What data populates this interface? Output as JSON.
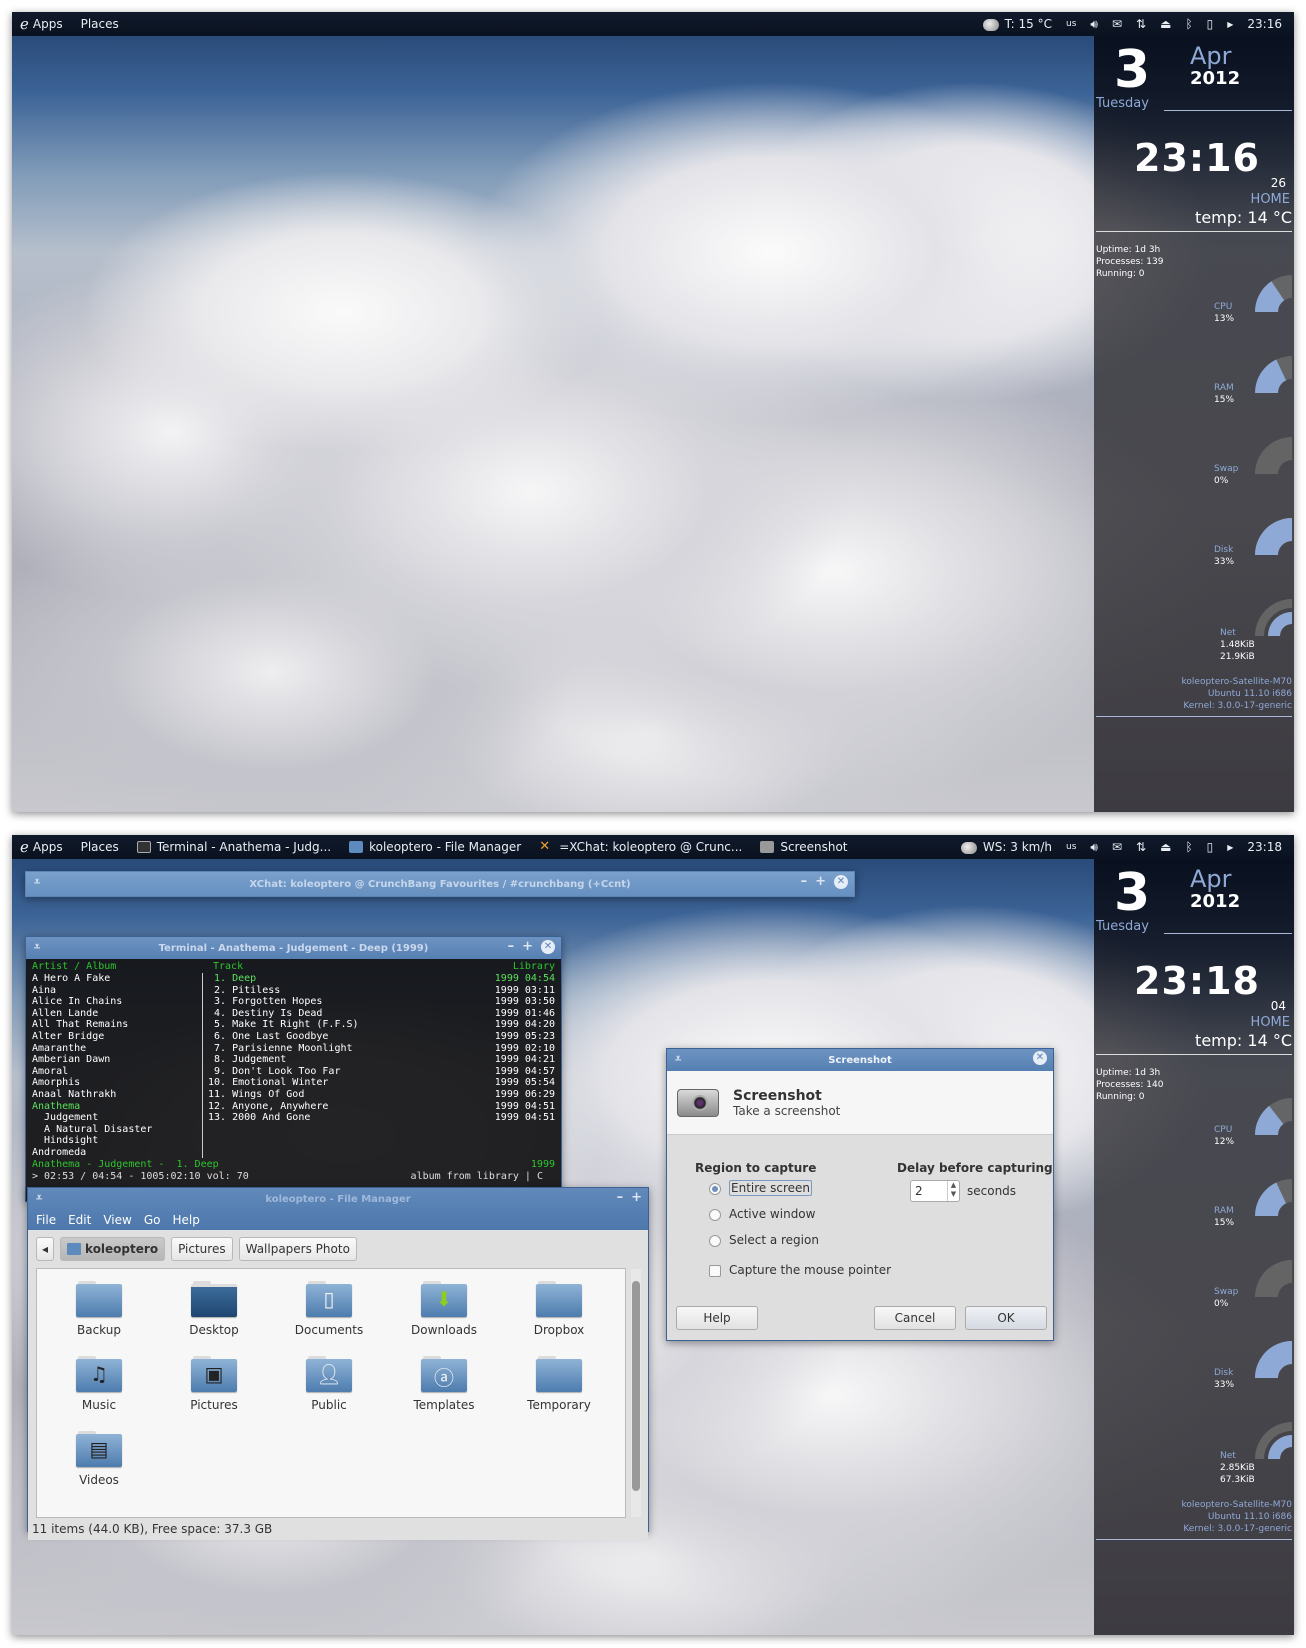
{
  "screens": [
    {
      "panel": {
        "apps": "Apps",
        "places": "Places",
        "tasks": [],
        "weather": "T: 15 °C",
        "keyboard": "us",
        "clock": "23:16"
      },
      "conky": {
        "day": "3",
        "month": "Apr",
        "year": "2012",
        "weekday": "Tuesday",
        "time": "23:16",
        "seconds": "26",
        "location": "HOME",
        "temp": "temp: 14 °C",
        "uptime": "Uptime: 1d 3h",
        "processes": "Processes: 139",
        "running": "Running: 0",
        "gauges": [
          {
            "label": "CPU",
            "value_text": "13%",
            "percent": 13
          },
          {
            "label": "RAM",
            "value_text": "15%",
            "percent": 15
          },
          {
            "label": "Swap",
            "value_text": "0%",
            "percent": 0
          },
          {
            "label": "Disk",
            "value_text": "33%",
            "percent": 33
          }
        ],
        "net": {
          "label": "Net",
          "down": "1.48KiB",
          "up": "21.9KiB"
        },
        "host": "koleoptero-Satellite-M70",
        "os": "Ubuntu 11.10  i686",
        "kernel": "Kernel: 3.0.0-17-generic"
      }
    },
    {
      "panel": {
        "apps": "Apps",
        "places": "Places",
        "tasks": [
          "Terminal - Anathema - Judg...",
          "koleoptero - File Manager",
          "=XChat: koleoptero @ Crunc...",
          "Screenshot"
        ],
        "weather": "WS: 3 km/h",
        "keyboard": "us",
        "clock": "23:18"
      },
      "conky": {
        "day": "3",
        "month": "Apr",
        "year": "2012",
        "weekday": "Tuesday",
        "time": "23:18",
        "seconds": "04",
        "location": "HOME",
        "temp": "temp: 14 °C",
        "uptime": "Uptime: 1d 3h",
        "processes": "Processes: 140",
        "running": "Running: 0",
        "gauges": [
          {
            "label": "CPU",
            "value_text": "12%",
            "percent": 12
          },
          {
            "label": "RAM",
            "value_text": "15%",
            "percent": 15
          },
          {
            "label": "Swap",
            "value_text": "0%",
            "percent": 0
          },
          {
            "label": "Disk",
            "value_text": "33%",
            "percent": 33
          }
        ],
        "net": {
          "label": "Net",
          "down": "2.85KiB",
          "up": "67.3KiB"
        },
        "host": "koleoptero-Satellite-M70",
        "os": "Ubuntu 11.10  i686",
        "kernel": "Kernel: 3.0.0-17-generic"
      }
    }
  ],
  "xchat": {
    "title": "XChat: koleoptero @ CrunchBang Favourites / #crunchbang (+Ccnt)"
  },
  "terminal": {
    "title": "Terminal - Anathema - Judgement - Deep (1999)",
    "headers": {
      "artist": "Artist / Album",
      "track": "Track",
      "library": "Library"
    },
    "artists": [
      {
        "name": "A Hero A Fake"
      },
      {
        "name": "Aina"
      },
      {
        "name": "Alice In Chains"
      },
      {
        "name": "Allen Lande"
      },
      {
        "name": "All That Remains"
      },
      {
        "name": "Alter Bridge"
      },
      {
        "name": "Amaranthe"
      },
      {
        "name": "Amberian Dawn"
      },
      {
        "name": "Amoral"
      },
      {
        "name": "Amorphis"
      },
      {
        "name": "Anaal Nathrakh"
      },
      {
        "name": "Anathema",
        "selected": true
      },
      {
        "name": "  Judgement"
      },
      {
        "name": "  A Natural Disaster"
      },
      {
        "name": "  Hindsight"
      },
      {
        "name": "Andromeda"
      }
    ],
    "tracks": [
      {
        "n": " 1.",
        "title": "Deep",
        "meta": "1999 04:54",
        "playing": true
      },
      {
        "n": " 2.",
        "title": "Pitiless",
        "meta": "1999 03:11"
      },
      {
        "n": " 3.",
        "title": "Forgotten Hopes",
        "meta": "1999 03:50"
      },
      {
        "n": " 4.",
        "title": "Destiny Is Dead",
        "meta": "1999 01:46"
      },
      {
        "n": " 5.",
        "title": "Make It Right (F.F.S)",
        "meta": "1999 04:20"
      },
      {
        "n": " 6.",
        "title": "One Last Goodbye",
        "meta": "1999 05:23"
      },
      {
        "n": " 7.",
        "title": "Parisienne Moonlight",
        "meta": "1999 02:10"
      },
      {
        "n": " 8.",
        "title": "Judgement",
        "meta": "1999 04:21"
      },
      {
        "n": " 9.",
        "title": "Don't Look Too Far",
        "meta": "1999 04:57"
      },
      {
        "n": "10.",
        "title": "Emotional Winter",
        "meta": "1999 05:54"
      },
      {
        "n": "11.",
        "title": "Wings Of God",
        "meta": "1999 06:29"
      },
      {
        "n": "12.",
        "title": "Anyone, Anywhere",
        "meta": "1999 04:51"
      },
      {
        "n": "13.",
        "title": "2000 And Gone",
        "meta": "1999 04:51"
      }
    ],
    "now_playing": "Anathema - Judgement -  1. Deep",
    "now_year": "1999",
    "progress": "> 02:53 / 04:54 - 1005:02:10 vol: 70",
    "mode": "album from library | C"
  },
  "filemanager": {
    "title": "koleoptero - File Manager",
    "menu": [
      "File",
      "Edit",
      "View",
      "Go",
      "Help"
    ],
    "breadcrumbs": [
      "koleoptero",
      "Pictures",
      "Wallpapers Photo"
    ],
    "items": [
      {
        "name": "Backup",
        "icon": "folder"
      },
      {
        "name": "Desktop",
        "icon": "desktop"
      },
      {
        "name": "Documents",
        "icon": "documents"
      },
      {
        "name": "Downloads",
        "icon": "downloads"
      },
      {
        "name": "Dropbox",
        "icon": "folder"
      },
      {
        "name": "Music",
        "icon": "music"
      },
      {
        "name": "Pictures",
        "icon": "pictures"
      },
      {
        "name": "Public",
        "icon": "public"
      },
      {
        "name": "Templates",
        "icon": "templates"
      },
      {
        "name": "Temporary",
        "icon": "folder"
      },
      {
        "name": "Videos",
        "icon": "videos"
      }
    ],
    "status": "11 items (44.0 KB), Free space: 37.3 GB"
  },
  "screenshot_dialog": {
    "window_title": "Screenshot",
    "heading": "Screenshot",
    "subheading": "Take a screenshot",
    "region_label": "Region to capture",
    "options": [
      {
        "label": "Entire screen",
        "selected": true
      },
      {
        "label": "Active window",
        "selected": false
      },
      {
        "label": "Select a region",
        "selected": false
      }
    ],
    "capture_pointer": {
      "label": "Capture the mouse pointer",
      "checked": false
    },
    "delay_label": "Delay before capturing",
    "delay_value": "2",
    "delay_unit": "seconds",
    "buttons": {
      "help": "Help",
      "cancel": "Cancel",
      "ok": "OK"
    }
  },
  "colors": {
    "conky_accent": "#8fa9d6",
    "titlebar": "#5a84b6",
    "term_green": "#5be05b"
  }
}
